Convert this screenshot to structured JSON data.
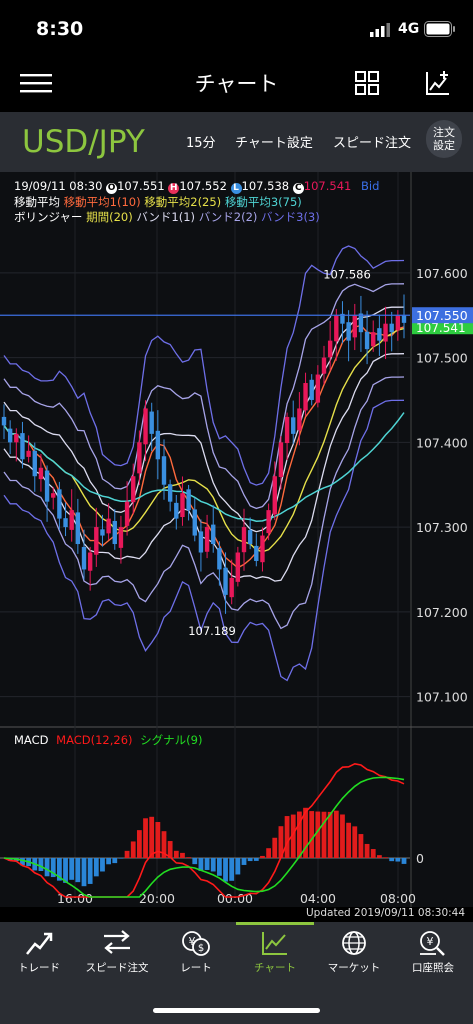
{
  "status": {
    "time": "8:30",
    "network": "4G"
  },
  "header": {
    "title": "チャート"
  },
  "currency": {
    "pair": "USD/JPY",
    "interval": "15分",
    "chart_settings": "チャート設定",
    "speed_order": "スピード注文",
    "order_settings_line1": "注文",
    "order_settings_line2": "設定"
  },
  "ohlc": {
    "datetime": "19/09/11 08:30",
    "open_badge": "O",
    "open": "107.551",
    "high_badge": "H",
    "high": "107.552",
    "low_badge": "L",
    "low": "107.538",
    "close_badge": "C",
    "close": "107.541",
    "side": "Bid"
  },
  "indicators": {
    "ma_label": "移動平均",
    "ma1": "移動平均1(10)",
    "ma2": "移動平均2(25)",
    "ma3": "移動平均3(75)",
    "bb_label": "ボリンジャー",
    "bb_period": "期間(20)",
    "band1": "バンド1(1)",
    "band2": "バンド2(2)",
    "band3": "バンド3(3)"
  },
  "annotations": {
    "high": "107.586",
    "low": "107.189"
  },
  "price_tags": {
    "bid": "107.550",
    "last": "107.541"
  },
  "macd": {
    "title": "MACD",
    "macd": "MACD(12,26)",
    "signal": "シグナル(9)"
  },
  "updated": "Updated  2019/09/11 08:30:44",
  "nav": [
    {
      "label": "トレード",
      "icon": "trade-icon"
    },
    {
      "label": "スピード注文",
      "icon": "speed-order-icon"
    },
    {
      "label": "レート",
      "icon": "rate-icon"
    },
    {
      "label": "チャート",
      "icon": "chart-icon"
    },
    {
      "label": "マーケット",
      "icon": "globe-icon"
    },
    {
      "label": "口座照会",
      "icon": "account-icon"
    }
  ],
  "colors": {
    "accent_green": "#8dc63f",
    "bull": "#e8185a",
    "bear": "#3a8fe0",
    "ma1": "#ff6a3d",
    "ma2": "#e6e04a",
    "ma3": "#4fd4d4",
    "band1": "#dcdcf0",
    "band2": "#a7a4e8",
    "band3": "#6e6fe8",
    "macd": "#ff1a1a",
    "signal": "#22dd22"
  },
  "chart_data": {
    "type": "candlestick",
    "y_ticks": [
      "107.600",
      "107.500",
      "107.400",
      "107.300",
      "107.200",
      "107.100"
    ],
    "ylim": [
      107.07,
      107.66
    ],
    "x_ticks": [
      "16:00",
      "20:00",
      "00:00",
      "04:00",
      "08:00"
    ],
    "macd_zero_label": "0",
    "close_series": [
      107.42,
      107.4,
      107.41,
      107.38,
      107.39,
      107.36,
      107.37,
      107.33,
      107.34,
      107.31,
      107.3,
      107.32,
      107.28,
      107.25,
      107.27,
      107.3,
      107.29,
      107.31,
      107.28,
      107.3,
      107.33,
      107.36,
      107.4,
      107.44,
      107.41,
      107.38,
      107.35,
      107.33,
      107.31,
      107.34,
      107.32,
      107.29,
      107.27,
      107.3,
      107.28,
      107.25,
      107.22,
      107.24,
      107.27,
      107.3,
      107.28,
      107.26,
      107.29,
      107.32,
      107.36,
      107.4,
      107.43,
      107.41,
      107.44,
      107.47,
      107.45,
      107.48,
      107.5,
      107.52,
      107.55,
      107.54,
      107.52,
      107.55,
      107.53,
      107.51,
      107.53,
      107.52,
      107.54,
      107.53,
      107.55,
      107.541
    ]
  }
}
